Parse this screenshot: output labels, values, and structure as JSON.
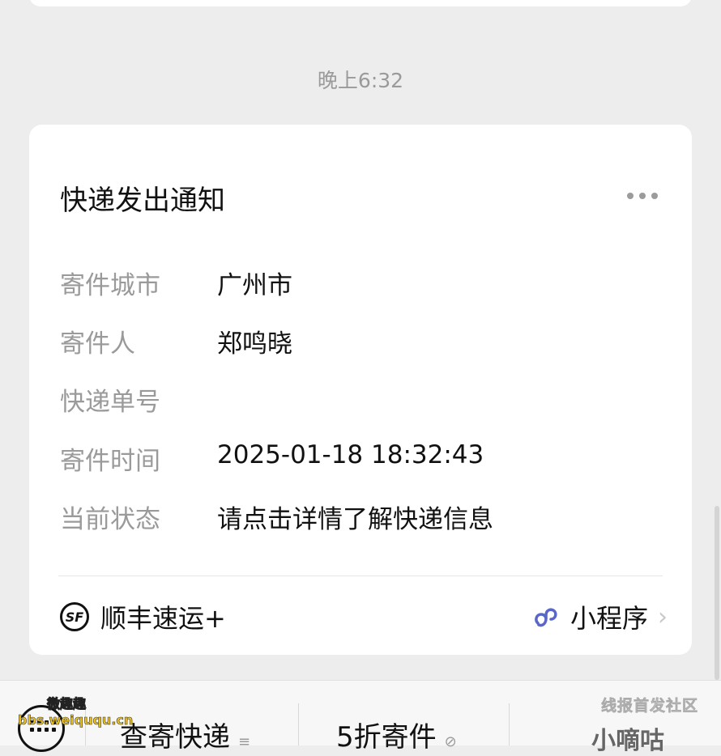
{
  "chat": {
    "timestamp": "晚上6:32"
  },
  "card": {
    "title": "快递发出通知",
    "rows": [
      {
        "label": "寄件城市",
        "value": "广州市"
      },
      {
        "label": "寄件人",
        "value": "郑鸣晓"
      },
      {
        "label": "快递单号",
        "value": ""
      },
      {
        "label": "寄件时间",
        "value": "2025-01-18 18:32:43"
      },
      {
        "label": "当前状态",
        "value": "请点击详情了解快递信息"
      }
    ],
    "service_logo_text": "SF",
    "service_name": "顺丰速运+",
    "mini_program_label": "小程序"
  },
  "bottom_menu": {
    "items": [
      {
        "label": "查寄快递"
      },
      {
        "label": "5折寄件"
      }
    ],
    "right_partial": "小嘀咕"
  },
  "watermarks": {
    "top_left": "微趣趣",
    "url": "bbs.weiququ.cn",
    "top_right": "线报首发社区"
  },
  "icons": {
    "more": "ellipsis-icon",
    "mini_program": "mini-program-icon",
    "chevron": "chevron-right-icon",
    "keyboard": "keyboard-icon",
    "menu": "menu-lines-icon",
    "link": "link-icon"
  }
}
